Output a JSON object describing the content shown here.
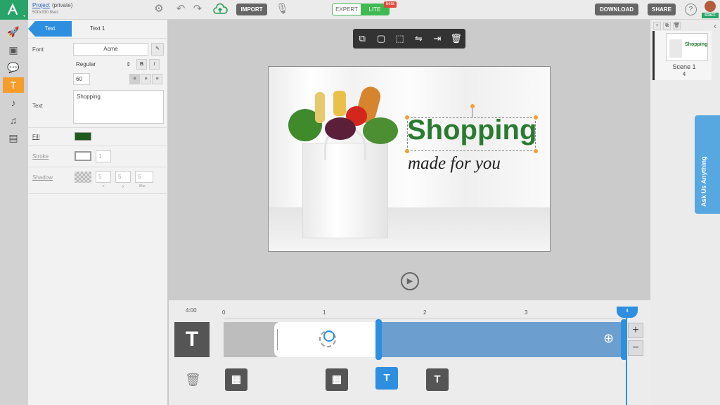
{
  "header": {
    "project_link": "Project",
    "project_privacy": "(private)",
    "project_meta": "500x330  8sec",
    "import_label": "IMPORT",
    "mode_expert": "EXPERT",
    "mode_lite": "LITE",
    "beta_badge": "beta",
    "download_label": "DOWNLOAD",
    "share_label": "SHARE",
    "help_icon": "?",
    "staff_badge": "STAFF"
  },
  "panel": {
    "tab_active": "Text",
    "tab_name": "Text 1",
    "font_label": "Font",
    "font_value": "Acme",
    "style_value": "Regular",
    "bold": "B",
    "italic": "I",
    "size_value": "60",
    "text_label": "Text",
    "text_value": "Shopping",
    "fill_label": "Fill",
    "fill_color": "#1e5a1e",
    "stroke_label": "Stroke",
    "stroke_value": "1",
    "shadow_label": "Shadow",
    "shadow_x": "5",
    "shadow_y": "5",
    "shadow_blur": "5",
    "shadow_x_label": "x",
    "shadow_y_label": "y",
    "shadow_blur_label": "Blur"
  },
  "canvas": {
    "headline": "Shopping",
    "tagline": "made for you"
  },
  "scenes": {
    "scene_title": "Scene 1",
    "scene_duration": "4",
    "thumb_text": "Shopping"
  },
  "askus": "Ask Us Anything",
  "timeline": {
    "duration": "4:00",
    "ticks": [
      "0",
      "1",
      "2",
      "3"
    ],
    "cursor_label": "4",
    "layer_letter": "T",
    "key_letter": "T"
  },
  "colors": {
    "accent": "#2e8fe0",
    "brand": "#28a468",
    "active_tool": "#f59c2b",
    "headline": "#2b7a32"
  }
}
